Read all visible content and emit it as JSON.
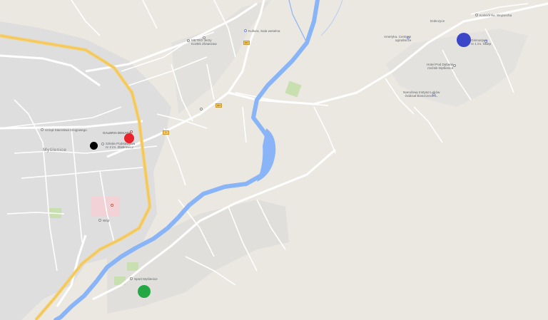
{
  "labels": {
    "tops_center": "Torfowo",
    "meteo": "METEO Jerzy\nKozłek Zlotaszaw",
    "kultura": "Kultura, Sala weselna",
    "kosciol": "Kościół św. Wojciecha",
    "ameryka": "Ameryka. Centrum\nogrodnicze",
    "dobczyce": "Dobczyce",
    "gimnazjum": "Gimnazjum\nnr 1 im. Sklep",
    "hotel": "Hotel Pod Dębami\nrzeźnik Myślenice",
    "narodowy": "Narodowy Instytut Leków\nOddział Bioszczecin L.",
    "galeria": "GALERIA DEKADA",
    "szkola": "Szkoła Podstawowa\nnr 2 im. Zbiskowicz",
    "urzad": "Urząd Starostwa Drogowego",
    "myslenice": "Myślenice",
    "wojt": "Wójt",
    "sport": "Sport Myślenice",
    "shield_1": "967",
    "shield_2": "967",
    "shield_3": "7"
  },
  "markers": [
    {
      "name": "red-marker",
      "color": "#e8232c"
    },
    {
      "name": "black-marker",
      "color": "#000000"
    },
    {
      "name": "blue-marker",
      "color": "#3b46c8"
    },
    {
      "name": "green-marker",
      "color": "#23a843"
    }
  ],
  "colors": {
    "land": "#ebe8e2",
    "urban": "#dcdcdc",
    "river": "#8ab4f8",
    "highway": "#f6cf6b",
    "road": "#ffffff",
    "park": "#c5e1a5",
    "hospital": "#f4cccc"
  }
}
